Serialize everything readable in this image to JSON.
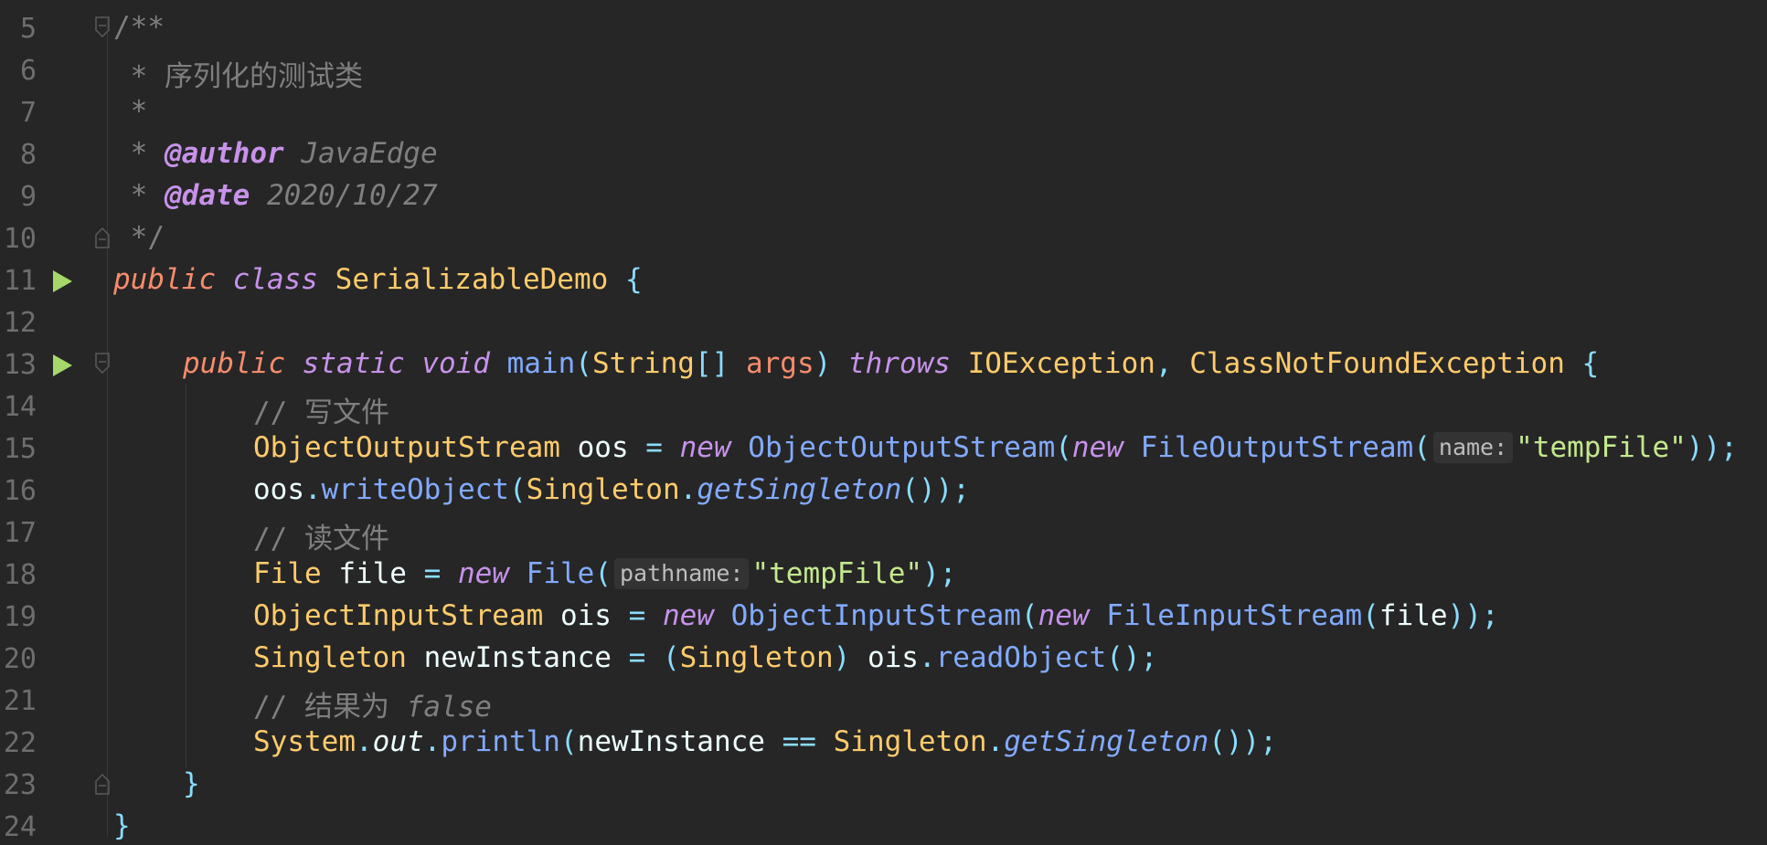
{
  "editor": {
    "theme_colors": {
      "background": "#262626",
      "keyword": "#c792ea",
      "type": "#ffcb6b",
      "function": "#82aaff",
      "string": "#c3e88d",
      "comment": "#7f7f7f",
      "punctuation": "#89ddff",
      "run_icon": "#a5d86a"
    },
    "line_numbers": [
      "5",
      "6",
      "7",
      "8",
      "9",
      "10",
      "11",
      "12",
      "13",
      "14",
      "15",
      "16",
      "17",
      "18",
      "19",
      "20",
      "21",
      "22",
      "23",
      "24"
    ],
    "code": {
      "l5": "/**",
      "l6_star": " * ",
      "l6_text": "序列化的测试类",
      "l7": " *",
      "l8_star": " * ",
      "l8_tag": "@author",
      "l8_val": " JavaEdge",
      "l9_star": " * ",
      "l9_tag": "@date",
      "l9_val": " 2020/10/27",
      "l10": " */",
      "l11_public": "public",
      "l11_class": "class",
      "l11_name": "SerializableDemo",
      "l11_brace": "{",
      "l13_public": "public",
      "l13_static": "static",
      "l13_void": "void",
      "l13_main": "main",
      "l13_p1": "(",
      "l13_string": "String",
      "l13_arr": "[]",
      "l13_args": "args",
      "l13_p2": ")",
      "l13_throws": "throws",
      "l13_ex1": "IOException",
      "l13_comma": ",",
      "l13_ex2": "ClassNotFoundException",
      "l13_brace": "{",
      "l14": "// 写文件",
      "l15_type": "ObjectOutputStream",
      "l15_var": " oos ",
      "l15_eq": "=",
      "l15_new1": "new",
      "l15_cls1": "ObjectOutputStream",
      "l15_p1": "(",
      "l15_new2": "new",
      "l15_cls2": "FileOutputStream",
      "l15_p2": "(",
      "l15_hint": "name:",
      "l15_str": "\"tempFile\"",
      "l15_end": "));",
      "l16_var": "oos",
      "l16_dot": ".",
      "l16_fn": "writeObject",
      "l16_p1": "(",
      "l16_cls": "Singleton",
      "l16_dot2": ".",
      "l16_fn2": "getSingleton",
      "l16_end": "());",
      "l17": "// 读文件",
      "l18_type": "File",
      "l18_var": " file ",
      "l18_eq": "=",
      "l18_new": "new",
      "l18_cls": "File",
      "l18_p1": "(",
      "l18_hint": "pathname:",
      "l18_str": "\"tempFile\"",
      "l18_end": ");",
      "l19_type": "ObjectInputStream",
      "l19_var": " ois ",
      "l19_eq": "=",
      "l19_new1": "new",
      "l19_cls1": "ObjectInputStream",
      "l19_p1": "(",
      "l19_new2": "new",
      "l19_cls2": "FileInputStream",
      "l19_p2": "(",
      "l19_arg": "file",
      "l19_end": "));",
      "l20_type": "Singleton",
      "l20_var": " newInstance ",
      "l20_eq": "=",
      "l20_p1": "(",
      "l20_cast": "Singleton",
      "l20_p2": ")",
      "l20_obj": " ois",
      "l20_dot": ".",
      "l20_fn": "readObject",
      "l20_end": "();",
      "l21_a": "// 结果为 ",
      "l21_b": "false",
      "l22_sys": "System",
      "l22_dot1": ".",
      "l22_out": "out",
      "l22_dot2": ".",
      "l22_fn": "println",
      "l22_p1": "(",
      "l22_arg": "newInstance ",
      "l22_eq": "==",
      "l22_cls": " Singleton",
      "l22_dot3": ".",
      "l22_fn2": "getSingleton",
      "l22_end": "());",
      "l23": "}",
      "l24": "}"
    }
  }
}
